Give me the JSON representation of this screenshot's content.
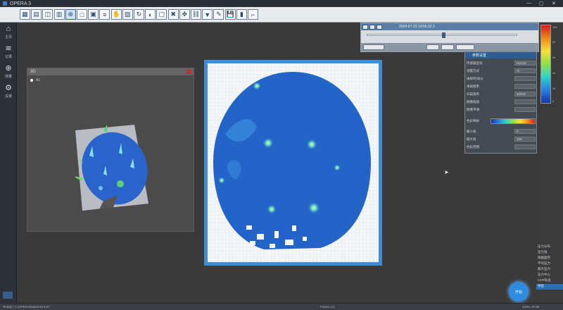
{
  "window": {
    "title": "OPERA 3",
    "title_red": "",
    "controls": [
      "—",
      "▢",
      "✕"
    ]
  },
  "toolbar": {
    "buttons": [
      "grid-icon",
      "chart-icon",
      "layers-icon",
      "table-icon",
      "target-icon",
      "select-icon",
      "box-icon",
      "list-icon",
      "hand-icon",
      "image-icon",
      "rotate-icon",
      "palette-icon",
      "frame-icon",
      "close-icon",
      "move-icon",
      "link-icon",
      "filter-icon",
      "pen-icon",
      "save-icon",
      "bars-icon",
      "ruler-icon"
    ],
    "active_index": 4
  },
  "sidebar": {
    "items": [
      {
        "icon": "home-icon",
        "label": "主页"
      },
      {
        "icon": "database-icon",
        "label": "记录"
      },
      {
        "icon": "crosshair-icon",
        "label": "测量"
      },
      {
        "icon": "settings-icon",
        "label": "设置"
      }
    ]
  },
  "panel3d": {
    "title": "3D",
    "legend": "A1"
  },
  "control_panel": {
    "path": "2024-07-23 14:56:33 2"
  },
  "param_panel": {
    "title": "参数设置",
    "rows": [
      {
        "label": "传感器型号",
        "value": "HyC22"
      },
      {
        "label": "测量方式",
        "value": "AI"
      },
      {
        "label": "采样时间(s)",
        "value": ""
      },
      {
        "label": "采样频率",
        "value": ""
      },
      {
        "label": "扫描速率",
        "value": "500Hz"
      },
      {
        "label": "图像插值",
        "value": ""
      },
      {
        "label": "图像平滑",
        "value": ""
      },
      {
        "label": "色彩映射",
        "value": ""
      },
      {
        "label": "最小值",
        "value": "0"
      },
      {
        "label": "最大值",
        "value": "100"
      },
      {
        "label": "色标范围",
        "value": ""
      }
    ]
  },
  "colorbar": {
    "ticks": [
      "100",
      "80",
      "60",
      "40",
      "20",
      "0"
    ]
  },
  "right_list": {
    "items": [
      "压力分布",
      "压力值",
      "接触面积",
      "平均压力",
      "最大压力",
      "压力中心",
      "COP轨迹",
      "导出"
    ]
  },
  "fab": {
    "label": "开始"
  },
  "statusbar": {
    "left": "Ready | C:\\OPERA\\Data\\2024-07",
    "mid": "Frame 1/1",
    "right": "100%  15:36"
  },
  "colors": {
    "accent": "#2f8be0",
    "plate_blue": "#1f5fc6",
    "frame": "#3f8ed4"
  }
}
